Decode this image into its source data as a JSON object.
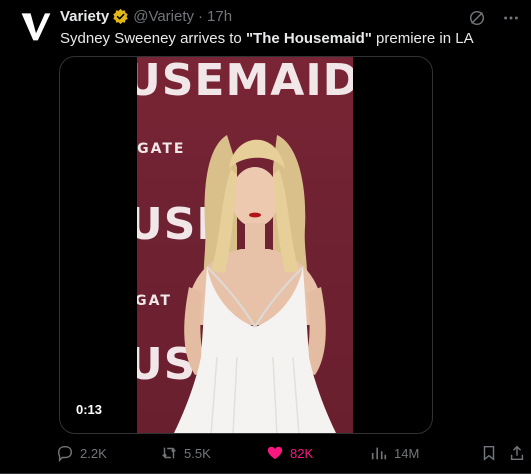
{
  "tweet": {
    "author_name": "Variety",
    "handle": "@Variety",
    "dot": "·",
    "time": "17h",
    "text_before": "Sydney Sweeney arrives to ",
    "text_bold": "\"The Housemaid\"",
    "text_after": " premiere in LA"
  },
  "media": {
    "duration": "0:13",
    "backdrop_texts": [
      "USEMAID",
      "SGATE",
      "USE",
      "SGAT",
      "USE"
    ]
  },
  "actions": {
    "replies": "2.2K",
    "reposts": "5.5K",
    "likes": "82K",
    "views": "14M"
  },
  "colors": {
    "background": "#000000",
    "text": "#e7e9ea",
    "muted": "#71767b",
    "like": "#f91880",
    "verified": "#e2b719",
    "backdrop": "#6f2232"
  },
  "icons": [
    "variety-logo-icon",
    "verified-badge-icon",
    "grok-icon",
    "more-icon",
    "reply-icon",
    "repost-icon",
    "like-icon",
    "views-icon",
    "bookmark-icon",
    "share-icon"
  ]
}
